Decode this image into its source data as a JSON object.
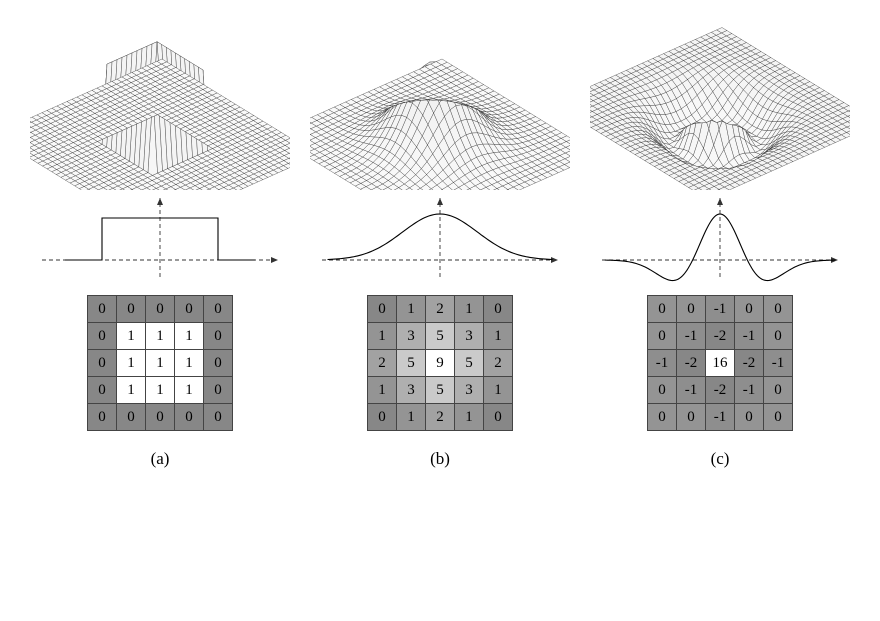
{
  "panels": [
    {
      "label": "(a)",
      "surface_type": "box",
      "profile_type": "box",
      "matrix": [
        [
          0,
          0,
          0,
          0,
          0
        ],
        [
          0,
          1,
          1,
          1,
          0
        ],
        [
          0,
          1,
          1,
          1,
          0
        ],
        [
          0,
          1,
          1,
          1,
          0
        ],
        [
          0,
          0,
          0,
          0,
          0
        ]
      ]
    },
    {
      "label": "(b)",
      "surface_type": "gaussian",
      "profile_type": "gaussian",
      "matrix": [
        [
          0,
          1,
          2,
          1,
          0
        ],
        [
          1,
          3,
          5,
          3,
          1
        ],
        [
          2,
          5,
          9,
          5,
          2
        ],
        [
          1,
          3,
          5,
          3,
          1
        ],
        [
          0,
          1,
          2,
          1,
          0
        ]
      ]
    },
    {
      "label": "(c)",
      "surface_type": "mexhat",
      "profile_type": "mexhat",
      "matrix": [
        [
          0,
          0,
          -1,
          0,
          0
        ],
        [
          0,
          -1,
          -2,
          -1,
          0
        ],
        [
          -1,
          -2,
          16,
          -2,
          -1
        ],
        [
          0,
          -1,
          -2,
          -1,
          0
        ],
        [
          0,
          0,
          -1,
          0,
          0
        ]
      ]
    }
  ],
  "chart_data": [
    {
      "type": "surface",
      "name": "box-filter-3d",
      "description": "3D wireframe plot of a box/uniform filter on a flat grid: value 1 inside a centered square region, 0 outside.",
      "xrange": [
        -1,
        1
      ],
      "yrange": [
        -1,
        1
      ],
      "zrange": [
        0,
        1
      ]
    },
    {
      "type": "line",
      "name": "box-filter-profile",
      "x": [
        -1.5,
        -0.6,
        -0.6,
        0.6,
        0.6,
        1.5
      ],
      "y": [
        0,
        0,
        1,
        1,
        0,
        0
      ]
    },
    {
      "type": "table",
      "name": "box-filter-kernel",
      "rows": [
        [
          0,
          0,
          0,
          0,
          0
        ],
        [
          0,
          1,
          1,
          1,
          0
        ],
        [
          0,
          1,
          1,
          1,
          0
        ],
        [
          0,
          1,
          1,
          1,
          0
        ],
        [
          0,
          0,
          0,
          0,
          0
        ]
      ]
    },
    {
      "type": "surface",
      "name": "gaussian-3d",
      "description": "3D wireframe Gaussian bump on a flat grid, smooth bell shape centered at origin.",
      "xrange": [
        -1,
        1
      ],
      "yrange": [
        -1,
        1
      ],
      "zrange": [
        0,
        1
      ]
    },
    {
      "type": "line",
      "name": "gaussian-profile",
      "x": [
        -1.5,
        -1.2,
        -0.9,
        -0.6,
        -0.3,
        0,
        0.3,
        0.6,
        0.9,
        1.2,
        1.5
      ],
      "y": [
        0.01,
        0.06,
        0.2,
        0.49,
        0.84,
        1.0,
        0.84,
        0.49,
        0.2,
        0.06,
        0.01
      ]
    },
    {
      "type": "table",
      "name": "gaussian-kernel",
      "rows": [
        [
          0,
          1,
          2,
          1,
          0
        ],
        [
          1,
          3,
          5,
          3,
          1
        ],
        [
          2,
          5,
          9,
          5,
          2
        ],
        [
          1,
          3,
          5,
          3,
          1
        ],
        [
          0,
          1,
          2,
          1,
          0
        ]
      ]
    },
    {
      "type": "surface",
      "name": "mexhat-3d",
      "description": "3D wireframe Laplacian-of-Gaussian / Mexican-hat: tall central peak with a surrounding negative depression, flattening to zero outward.",
      "xrange": [
        -1,
        1
      ],
      "yrange": [
        -1,
        1
      ],
      "zrange": [
        -0.3,
        1
      ]
    },
    {
      "type": "line",
      "name": "mexhat-profile",
      "x": [
        -1.5,
        -1.0,
        -0.7,
        -0.45,
        -0.25,
        0,
        0.25,
        0.45,
        0.7,
        1.0,
        1.5
      ],
      "y": [
        0,
        -0.05,
        -0.15,
        0,
        0.7,
        1.0,
        0.7,
        0,
        -0.15,
        -0.05,
        0
      ]
    },
    {
      "type": "table",
      "name": "mexhat-kernel",
      "rows": [
        [
          0,
          0,
          -1,
          0,
          0
        ],
        [
          0,
          -1,
          -2,
          -1,
          0
        ],
        [
          -1,
          -2,
          16,
          -2,
          -1
        ],
        [
          0,
          -1,
          -2,
          -1,
          0
        ],
        [
          0,
          0,
          -1,
          0,
          0
        ]
      ]
    }
  ]
}
